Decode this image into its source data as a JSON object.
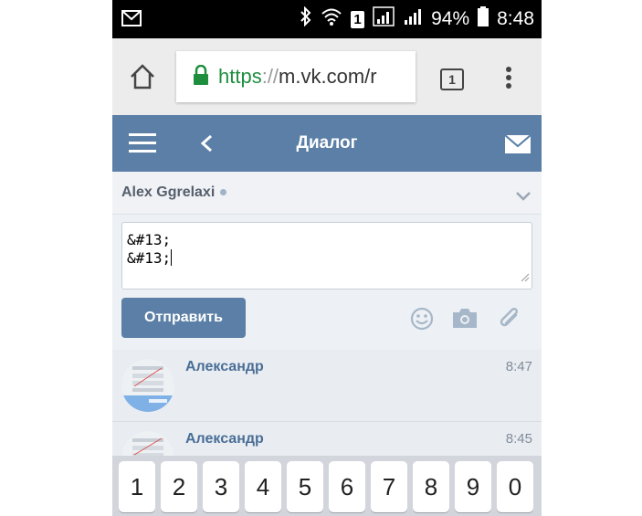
{
  "status_bar": {
    "battery": "94%",
    "time": "8:48",
    "sim_slot": "1",
    "icons": [
      "gmail-icon",
      "bluetooth-icon",
      "wifi-icon",
      "signal-icon",
      "battery-icon"
    ]
  },
  "browser": {
    "url_scheme": "https",
    "url_separator": "://",
    "url_host": "m.vk.com/r",
    "tab_count": "1",
    "icons": [
      "home-icon",
      "lock-icon",
      "more-vert-icon"
    ]
  },
  "header": {
    "title": "Диалог",
    "icons": [
      "hamburger-icon",
      "back-icon",
      "mail-icon"
    ]
  },
  "peer": {
    "name": "Alex Ggrelaxi"
  },
  "compose": {
    "text": "&#13;\n&#13;",
    "send_label": "Отправить",
    "icons": [
      "emoji-icon",
      "camera-icon",
      "attach-icon"
    ]
  },
  "messages": [
    {
      "author": "Александр",
      "time": "8:47"
    },
    {
      "author": "Александр",
      "time": "8:45"
    }
  ],
  "keyboard": {
    "keys": [
      "1",
      "2",
      "3",
      "4",
      "5",
      "6",
      "7",
      "8",
      "9",
      "0"
    ]
  },
  "colors": {
    "vk_blue": "#5b7fa6",
    "secure_green": "#1e8e3e",
    "author_blue": "#4a6e96"
  }
}
